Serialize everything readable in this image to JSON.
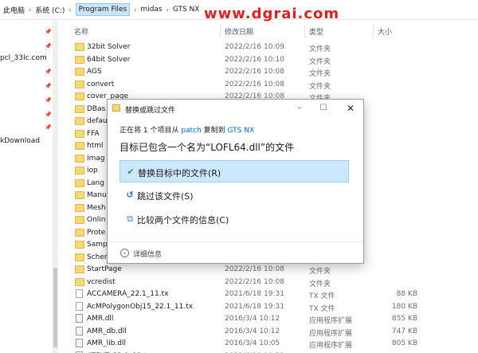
{
  "breadcrumbs": [
    "此电脑",
    "系统 (C:)",
    "Program Files",
    "midas",
    "GTS NX"
  ],
  "watermark": "www.dgrai.com",
  "nav_items": [
    "pcl_33lc.com",
    "kDownload"
  ],
  "columns": {
    "name": "名称",
    "date": "修改日期",
    "type": "类型",
    "size": "大小"
  },
  "files": [
    {
      "name": "32bit Solver",
      "date": "2022/2/16 10:09",
      "type": "文件夹",
      "size": "",
      "kind": "folder"
    },
    {
      "name": "64bit Solver",
      "date": "2022/2/16 10:10",
      "type": "文件夹",
      "size": "",
      "kind": "folder"
    },
    {
      "name": "AGS",
      "date": "2022/2/16 10:08",
      "type": "文件夹",
      "size": "",
      "kind": "folder"
    },
    {
      "name": "convert",
      "date": "2022/2/16 10:08",
      "type": "文件夹",
      "size": "",
      "kind": "folder"
    },
    {
      "name": "cover_page",
      "date": "2022/2/16 10:08",
      "type": "文件夹",
      "size": "",
      "kind": "folder"
    },
    {
      "name": "DBas",
      "date": "",
      "type": "",
      "size": "",
      "kind": "folder"
    },
    {
      "name": "defau",
      "date": "",
      "type": "",
      "size": "",
      "kind": "folder"
    },
    {
      "name": "FFA",
      "date": "",
      "type": "",
      "size": "",
      "kind": "folder"
    },
    {
      "name": "html",
      "date": "",
      "type": "",
      "size": "",
      "kind": "folder"
    },
    {
      "name": "Imag",
      "date": "",
      "type": "",
      "size": "",
      "kind": "folder"
    },
    {
      "name": "iop",
      "date": "",
      "type": "",
      "size": "",
      "kind": "folder"
    },
    {
      "name": "Lang",
      "date": "",
      "type": "",
      "size": "",
      "kind": "folder"
    },
    {
      "name": "Manu",
      "date": "",
      "type": "",
      "size": "",
      "kind": "folder"
    },
    {
      "name": "Mesh",
      "date": "",
      "type": "",
      "size": "",
      "kind": "folder"
    },
    {
      "name": "Onlin",
      "date": "",
      "type": "",
      "size": "",
      "kind": "folder"
    },
    {
      "name": "Prote",
      "date": "",
      "type": "",
      "size": "",
      "kind": "folder"
    },
    {
      "name": "Samp",
      "date": "",
      "type": "",
      "size": "",
      "kind": "folder"
    },
    {
      "name": "Scher",
      "date": "",
      "type": "",
      "size": "",
      "kind": "folder"
    },
    {
      "name": "StartPage",
      "date": "2022/2/16 10:08",
      "type": "文件夹",
      "size": "",
      "kind": "folder"
    },
    {
      "name": "vcredist",
      "date": "2022/2/16 10:08",
      "type": "文件夹",
      "size": "",
      "kind": "folder"
    },
    {
      "name": "ACCAMERA_22.1_11.tx",
      "date": "2021/6/18 19:31",
      "type": "TX 文件",
      "size": "88 KB",
      "kind": "file"
    },
    {
      "name": "AcMPolygonObj15_22.1_11.tx",
      "date": "2021/6/18 19:31",
      "type": "TX 文件",
      "size": "180 KB",
      "kind": "file"
    },
    {
      "name": "AMR.dll",
      "date": "2016/3/4 10:12",
      "type": "应用程序扩展",
      "size": "855 KB",
      "kind": "dll"
    },
    {
      "name": "AMR_db.dll",
      "date": "2016/3/4 10:12",
      "type": "应用程序扩展",
      "size": "747 KB",
      "kind": "dll"
    },
    {
      "name": "AMR_lib.dll",
      "date": "2016/3/4 10:05",
      "type": "应用程序扩展",
      "size": "805 KB",
      "kind": "dll"
    },
    {
      "name": "ATEXT_22.1_11.tx",
      "date": "2021/6/18 19:31",
      "type": "TX 文件",
      "size": "",
      "kind": "file"
    }
  ],
  "dialog": {
    "title": "替换或跳过文件",
    "status_prefix": "正在将 1 个项目从",
    "source": "patch",
    "status_mid": "复制到",
    "destination": "GTS NX",
    "heading": "目标已包含一个名为“LOFL64.dll”的文件",
    "options": [
      {
        "label": "替换目标中的文件(R)",
        "icon": "check-icon",
        "selected": true
      },
      {
        "label": "跳过该文件(S)",
        "icon": "skip-arrow-icon",
        "selected": false
      },
      {
        "label": "比较两个文件的信息(C)",
        "icon": "compare-icon",
        "selected": false
      }
    ],
    "details_label": "详细信息"
  }
}
